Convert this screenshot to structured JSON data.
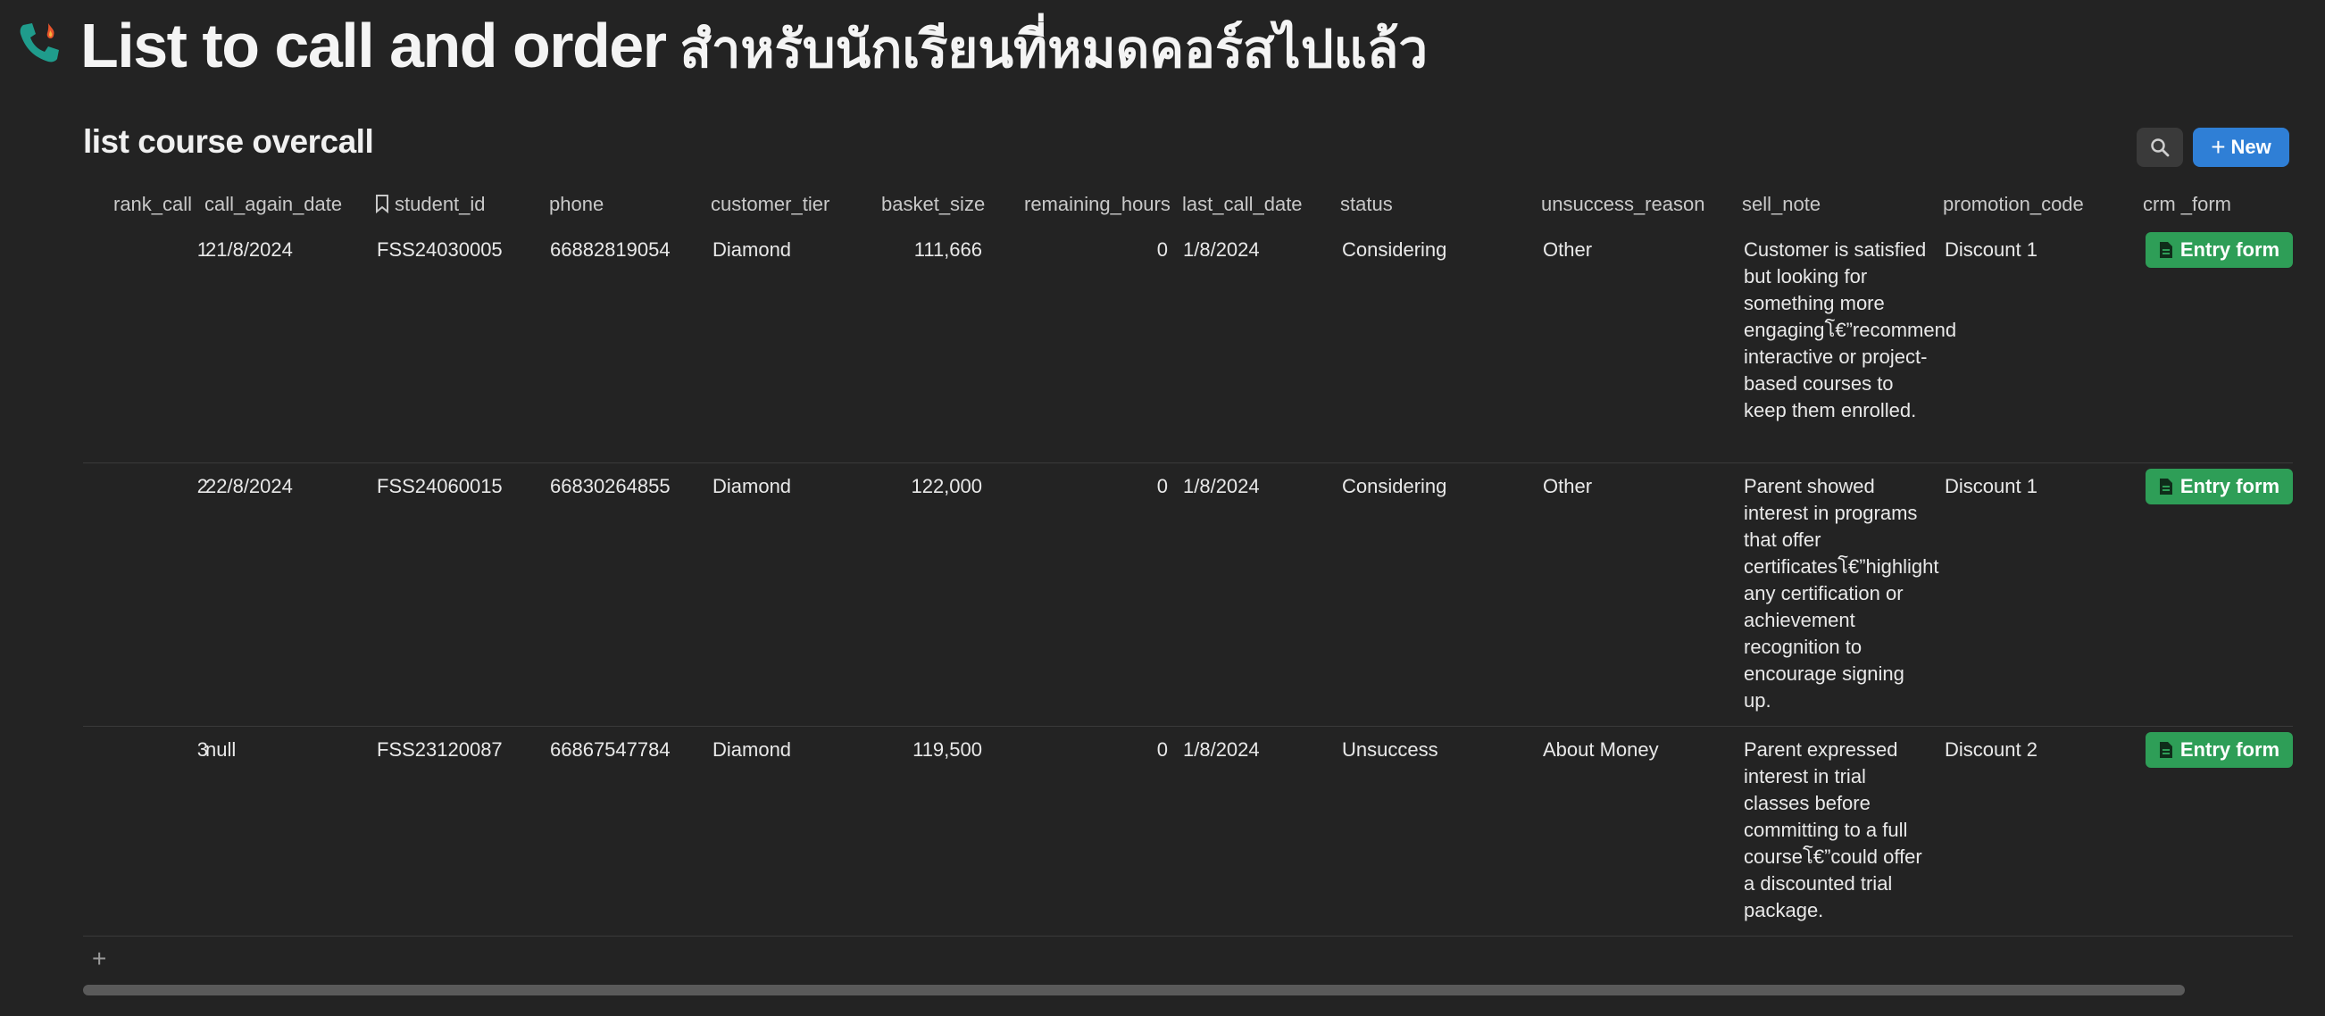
{
  "page": {
    "title": "List to call and order",
    "title_thai": "สำหรับนักเรียนที่หมดคอร์สไปแล้ว",
    "icon": "phone-with-fire-icon"
  },
  "view": {
    "title": "list course overcall",
    "search_icon": "search-icon",
    "new_label": "New"
  },
  "columns": {
    "rank_call": "rank_call",
    "call_again_date": "call_again_date",
    "student_id": "student_id",
    "phone": "phone",
    "customer_tier": "customer_tier",
    "basket_size": "basket_size",
    "remaining_hours": "remaining_hours",
    "last_call_date": "last_call_date",
    "status": "status",
    "unsuccess_reason": "unsuccess_reason",
    "sell_note": "sell_note",
    "promotion_code": "promotion_code",
    "crm_form": "crm _form"
  },
  "rows": [
    {
      "rank_call": "1",
      "call_again_date": "21/8/2024",
      "student_id": "FSS24030005",
      "phone": "66882819054",
      "customer_tier": "Diamond",
      "basket_size": "111,666",
      "remaining_hours": "0",
      "last_call_date": "1/8/2024",
      "status": "Considering",
      "unsuccess_reason": "Other",
      "sell_note": "Customer is satisfied but looking for something more engagingโ€”recommend interactive or project-based courses to keep them enrolled.",
      "promotion_code": "Discount 1",
      "crm_form": "Entry form"
    },
    {
      "rank_call": "2",
      "call_again_date": "22/8/2024",
      "student_id": "FSS24060015",
      "phone": "66830264855",
      "customer_tier": "Diamond",
      "basket_size": "122,000",
      "remaining_hours": "0",
      "last_call_date": "1/8/2024",
      "status": "Considering",
      "unsuccess_reason": "Other",
      "sell_note": "Parent showed interest in programs that offer certificatesโ€”highlight any certification or achievement recognition to encourage signing up.",
      "promotion_code": "Discount 1",
      "crm_form": "Entry form"
    },
    {
      "rank_call": "3",
      "call_again_date": "null",
      "student_id": "FSS23120087",
      "phone": "66867547784",
      "customer_tier": "Diamond",
      "basket_size": "119,500",
      "remaining_hours": "0",
      "last_call_date": "1/8/2024",
      "status": "Unsuccess",
      "unsuccess_reason": "About Money",
      "sell_note": "Parent expressed interest in trial classes before committing to a full courseโ€”could offer a discounted trial package.",
      "promotion_code": "Discount 2",
      "crm_form": "Entry form"
    }
  ],
  "add_row_label": "+",
  "colors": {
    "background": "#232323",
    "new_button": "#2f7fd6",
    "entry_button": "#2e9e57"
  }
}
